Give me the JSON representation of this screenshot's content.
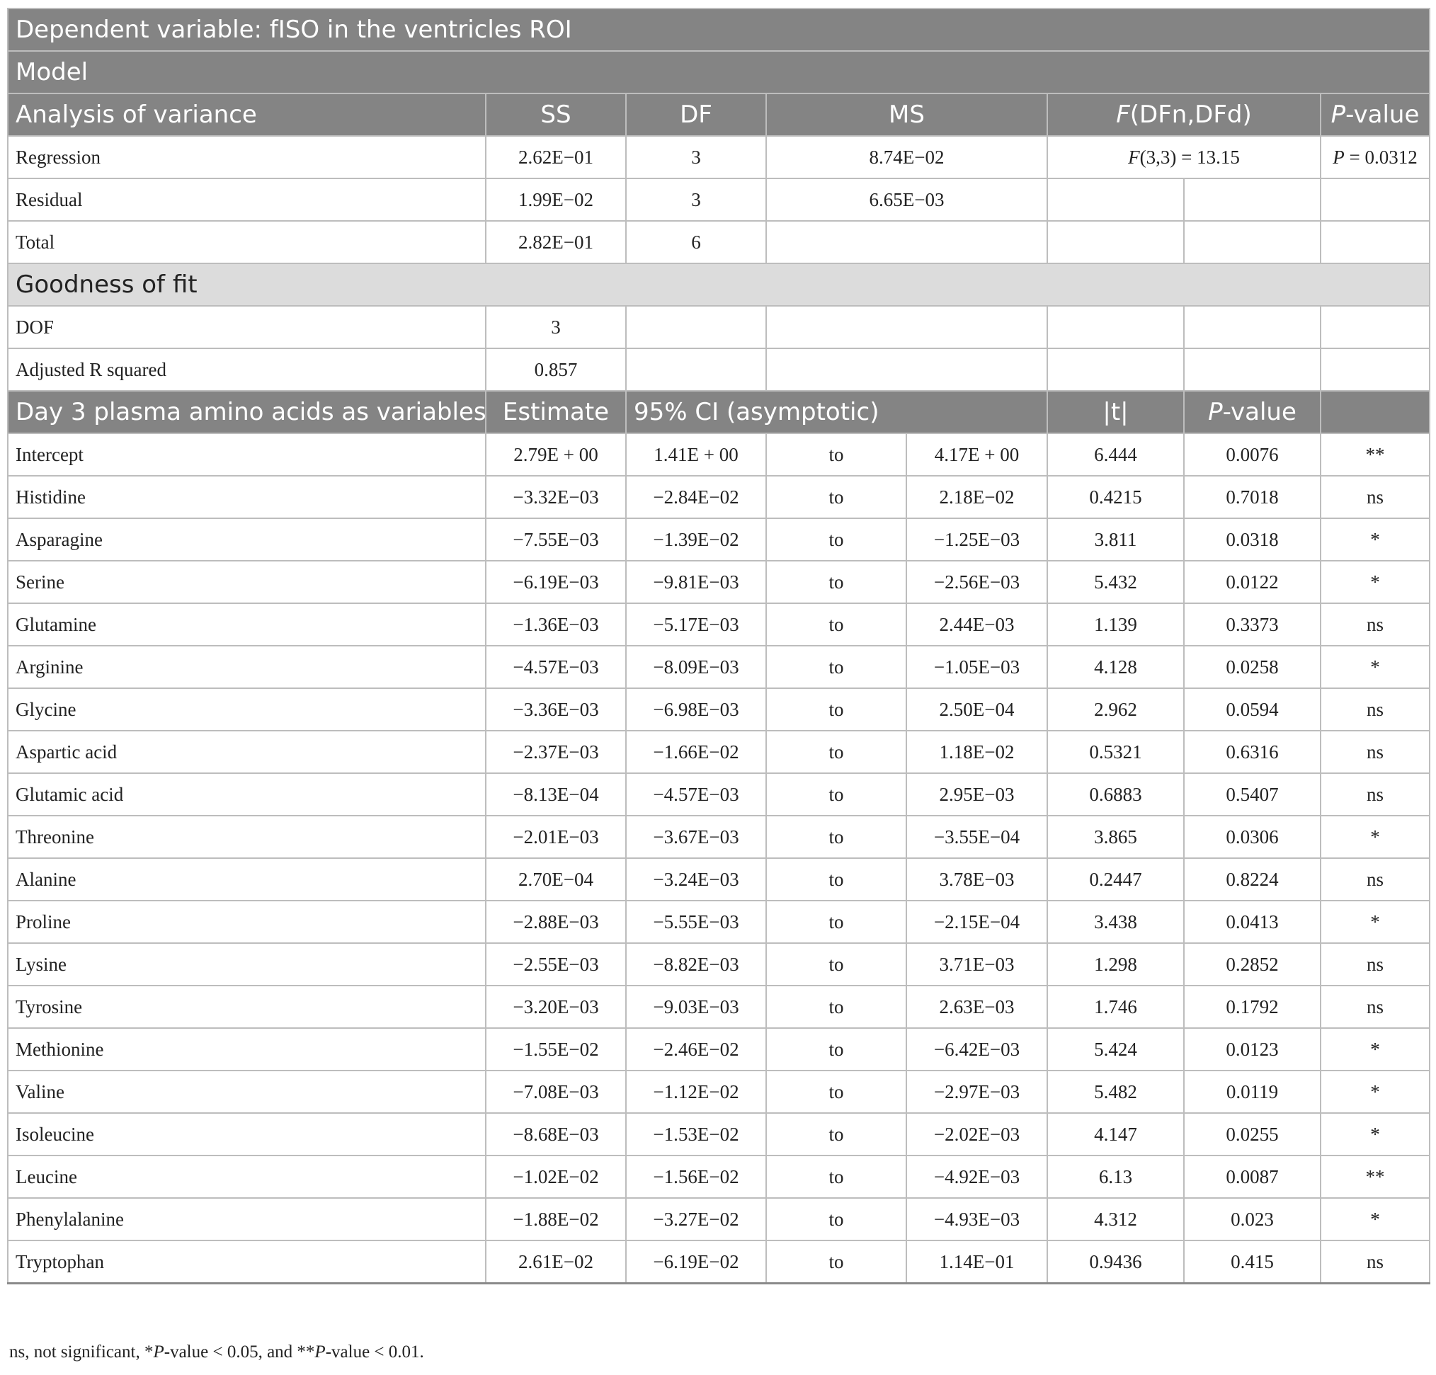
{
  "title": "Dependent variable: fISO in the ventricles ROI",
  "model_label": "Model",
  "anova": {
    "headers": [
      "Analysis of variance",
      "SS",
      "DF",
      "MS",
      "F(DFn,DFd)",
      "P-value"
    ],
    "rows": [
      {
        "label": "Regression",
        "ss": "2.62E−01",
        "df": "3",
        "ms": "8.74E−02",
        "f": "F(3,3) = 13.15",
        "p": "P = 0.0312"
      },
      {
        "label": "Residual",
        "ss": "1.99E−02",
        "df": "3",
        "ms": "6.65E−03",
        "f": "",
        "p": ""
      },
      {
        "label": "Total",
        "ss": "2.82E−01",
        "df": "6",
        "ms": "",
        "f": "",
        "p": ""
      }
    ]
  },
  "goodness": {
    "label": "Goodness of fit",
    "rows": [
      {
        "label": "DOF",
        "value": "3"
      },
      {
        "label": "Adjusted R squared",
        "value": "0.857"
      }
    ]
  },
  "variables": {
    "headers": [
      "Day 3 plasma amino acids as variables",
      "Estimate",
      "95% CI (asymptotic)",
      "|t|",
      "P-value",
      ""
    ],
    "rows": [
      {
        "name": "Intercept",
        "estimate": "2.79E + 00",
        "lo": "1.41E + 00",
        "to": "to",
        "hi": "4.17E + 00",
        "t": "6.444",
        "p": "0.0076",
        "sig": "**"
      },
      {
        "name": "Histidine",
        "estimate": "−3.32E−03",
        "lo": "−2.84E−02",
        "to": "to",
        "hi": "2.18E−02",
        "t": "0.4215",
        "p": "0.7018",
        "sig": "ns"
      },
      {
        "name": "Asparagine",
        "estimate": "−7.55E−03",
        "lo": "−1.39E−02",
        "to": "to",
        "hi": "−1.25E−03",
        "t": "3.811",
        "p": "0.0318",
        "sig": "*"
      },
      {
        "name": "Serine",
        "estimate": "−6.19E−03",
        "lo": "−9.81E−03",
        "to": "to",
        "hi": "−2.56E−03",
        "t": "5.432",
        "p": "0.0122",
        "sig": "*"
      },
      {
        "name": "Glutamine",
        "estimate": "−1.36E−03",
        "lo": "−5.17E−03",
        "to": "to",
        "hi": "2.44E−03",
        "t": "1.139",
        "p": "0.3373",
        "sig": "ns"
      },
      {
        "name": "Arginine",
        "estimate": "−4.57E−03",
        "lo": "−8.09E−03",
        "to": "to",
        "hi": "−1.05E−03",
        "t": "4.128",
        "p": "0.0258",
        "sig": "*"
      },
      {
        "name": "Glycine",
        "estimate": "−3.36E−03",
        "lo": "−6.98E−03",
        "to": "to",
        "hi": "2.50E−04",
        "t": "2.962",
        "p": "0.0594",
        "sig": "ns"
      },
      {
        "name": "Aspartic acid",
        "estimate": "−2.37E−03",
        "lo": "−1.66E−02",
        "to": "to",
        "hi": "1.18E−02",
        "t": "0.5321",
        "p": "0.6316",
        "sig": "ns"
      },
      {
        "name": "Glutamic acid",
        "estimate": "−8.13E−04",
        "lo": "−4.57E−03",
        "to": "to",
        "hi": "2.95E−03",
        "t": "0.6883",
        "p": "0.5407",
        "sig": "ns"
      },
      {
        "name": "Threonine",
        "estimate": "−2.01E−03",
        "lo": "−3.67E−03",
        "to": "to",
        "hi": "−3.55E−04",
        "t": "3.865",
        "p": "0.0306",
        "sig": "*"
      },
      {
        "name": "Alanine",
        "estimate": "2.70E−04",
        "lo": "−3.24E−03",
        "to": "to",
        "hi": "3.78E−03",
        "t": "0.2447",
        "p": "0.8224",
        "sig": "ns"
      },
      {
        "name": "Proline",
        "estimate": "−2.88E−03",
        "lo": "−5.55E−03",
        "to": "to",
        "hi": "−2.15E−04",
        "t": "3.438",
        "p": "0.0413",
        "sig": "*"
      },
      {
        "name": "Lysine",
        "estimate": "−2.55E−03",
        "lo": "−8.82E−03",
        "to": "to",
        "hi": "3.71E−03",
        "t": "1.298",
        "p": "0.2852",
        "sig": "ns"
      },
      {
        "name": "Tyrosine",
        "estimate": "−3.20E−03",
        "lo": "−9.03E−03",
        "to": "to",
        "hi": "2.63E−03",
        "t": "1.746",
        "p": "0.1792",
        "sig": "ns"
      },
      {
        "name": "Methionine",
        "estimate": "−1.55E−02",
        "lo": "−2.46E−02",
        "to": "to",
        "hi": "−6.42E−03",
        "t": "5.424",
        "p": "0.0123",
        "sig": "*"
      },
      {
        "name": "Valine",
        "estimate": "−7.08E−03",
        "lo": "−1.12E−02",
        "to": "to",
        "hi": "−2.97E−03",
        "t": "5.482",
        "p": "0.0119",
        "sig": "*"
      },
      {
        "name": "Isoleucine",
        "estimate": "−8.68E−03",
        "lo": "−1.53E−02",
        "to": "to",
        "hi": "−2.02E−03",
        "t": "4.147",
        "p": "0.0255",
        "sig": "*"
      },
      {
        "name": "Leucine",
        "estimate": "−1.02E−02",
        "lo": "−1.56E−02",
        "to": "to",
        "hi": "−4.92E−03",
        "t": "6.13",
        "p": "0.0087",
        "sig": "**"
      },
      {
        "name": "Phenylalanine",
        "estimate": "−1.88E−02",
        "lo": "−3.27E−02",
        "to": "to",
        "hi": "−4.93E−03",
        "t": "4.312",
        "p": "0.023",
        "sig": "*"
      },
      {
        "name": "Tryptophan",
        "estimate": "2.61E−02",
        "lo": "−6.19E−02",
        "to": "to",
        "hi": "1.14E−01",
        "t": "0.9436",
        "p": "0.415",
        "sig": "ns"
      }
    ]
  },
  "footnote": "ns, not significant, *P-value < 0.05, and **P-value < 0.01."
}
